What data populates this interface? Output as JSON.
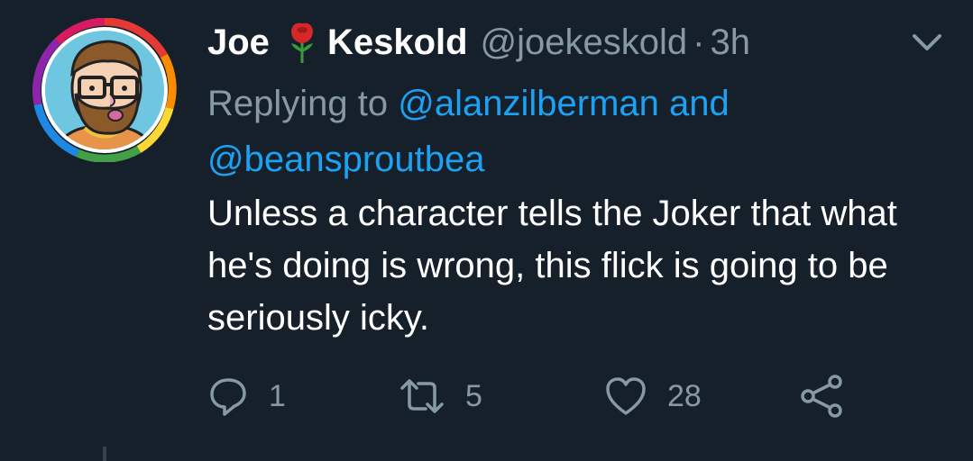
{
  "tweet": {
    "author": {
      "first_name": "Joe",
      "emoji": "rose-emoji",
      "last_name": "Keskold",
      "handle": "@joekeskold"
    },
    "separator": "·",
    "time": "3h",
    "reply": {
      "prefix": "Replying to",
      "mention1": "@alanzilberman",
      "and": "and",
      "mention2": "@beansproutbea"
    },
    "text": "Unless a character tells the Joker that what he's doing is wrong, this flick is going to be seriously icky.",
    "stats": {
      "replies": "1",
      "retweets": "5",
      "likes": "28"
    },
    "icons": [
      "chevron-down-icon",
      "reply-icon",
      "retweet-icon",
      "like-icon",
      "share-icon"
    ]
  },
  "colors": {
    "background": "#15202b",
    "text": "#ffffff",
    "muted": "#8899a6",
    "link": "#1da1f2"
  }
}
